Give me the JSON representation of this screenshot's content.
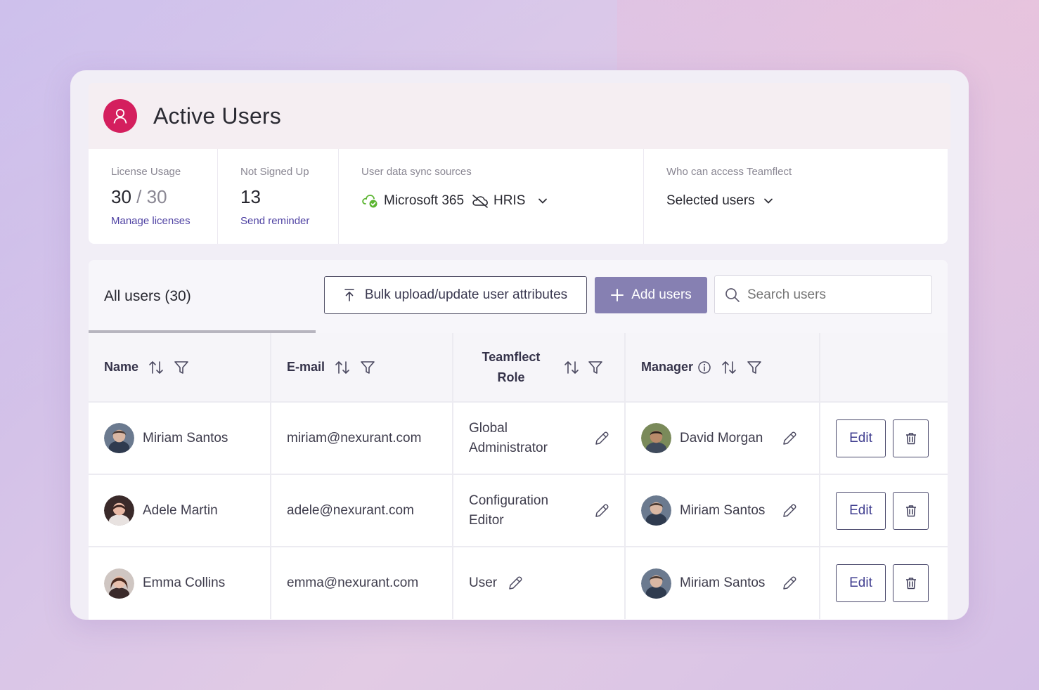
{
  "header": {
    "title": "Active Users"
  },
  "stats": {
    "license": {
      "label": "License Usage",
      "used": "30",
      "separator": "/",
      "total": "30",
      "link": "Manage licenses"
    },
    "not_signed": {
      "label": "Not Signed Up",
      "value": "13",
      "link": "Send reminder"
    },
    "sync": {
      "label": "User data sync sources",
      "source1": "Microsoft 365",
      "source2": "HRIS"
    },
    "access": {
      "label": "Who can access Teamflect",
      "value": "Selected users"
    }
  },
  "toolbar": {
    "tab_label": "All users (30)",
    "bulk_label": "Bulk upload/update user attributes",
    "add_label": "Add users",
    "search_placeholder": "Search users"
  },
  "table": {
    "headers": {
      "name": "Name",
      "email": "E-mail",
      "role_line1": "Teamflect",
      "role_line2": "Role",
      "manager": "Manager"
    },
    "rows": [
      {
        "name": "Miriam Santos",
        "email": "miriam@nexurant.com",
        "role_line1": "Global",
        "role_line2": "Administrator",
        "manager": "David Morgan",
        "edit": "Edit"
      },
      {
        "name": "Adele Martin",
        "email": "adele@nexurant.com",
        "role_line1": "Configuration",
        "role_line2": "Editor",
        "manager": "Miriam Santos",
        "edit": "Edit"
      },
      {
        "name": "Emma Collins",
        "email": "emma@nexurant.com",
        "role_line1": "User",
        "role_line2": "",
        "manager": "Miriam Santos",
        "edit": "Edit"
      }
    ]
  },
  "colors": {
    "accent": "#d41f5e",
    "primary_button": "#8680b2",
    "link": "#4f42a3"
  }
}
